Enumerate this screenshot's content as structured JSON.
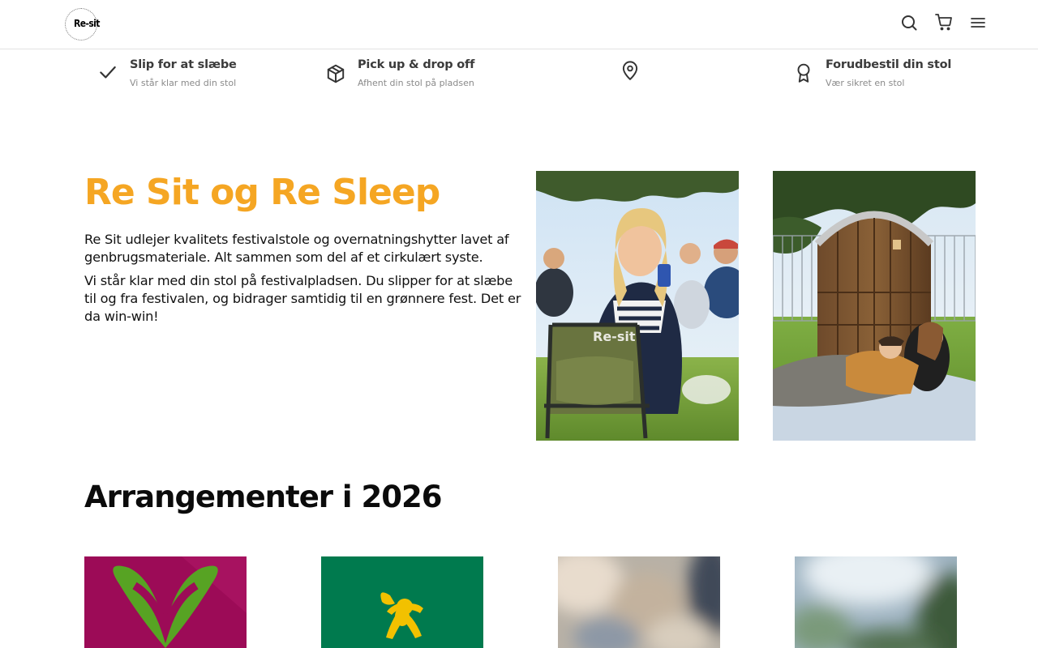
{
  "brand": {
    "logo_text": "Re-sit",
    "accent": "#f5a623"
  },
  "header": {
    "icons": [
      "search-icon",
      "cart-icon",
      "menu-icon"
    ]
  },
  "usps": [
    {
      "icon": "check-icon",
      "title": "Slip for at slæbe",
      "subtitle": "Vi står klar med din stol"
    },
    {
      "icon": "box-icon",
      "title": "Pick up & drop off",
      "subtitle": "Afhent din stol på pladsen"
    },
    {
      "icon": "map-pin-icon",
      "title": "",
      "subtitle": ""
    },
    {
      "icon": "award-icon",
      "title": "Forudbestil din stol",
      "subtitle": "Vær sikret en stol"
    }
  ],
  "hero": {
    "title": "Re Sit og Re Sleep",
    "paragraph_1": "Re Sit udlejer kvalitets festivalstole og overnatningshytter lavet af genbrugsmateriale. Alt sammen som del af et cirkulært syste.",
    "paragraph_2": "Vi står klar med din stol på festivalpladsen. Du slipper for at slæbe til og fra festivalen, og bidrager samtidig til en grønnere fest. Det er da win-win!",
    "photos": [
      {
        "name": "festival-chair-photo",
        "chair_print": "Re-sit"
      },
      {
        "name": "sleeping-hut-photo"
      }
    ]
  },
  "events": {
    "title": "Arrangementer i 2026",
    "cards": [
      {
        "name": "event-card-1",
        "bg": "#9c0b57"
      },
      {
        "name": "event-card-2",
        "bg": "#007a4e"
      },
      {
        "name": "event-card-3",
        "bg": "#b6aea2"
      },
      {
        "name": "event-card-4",
        "bg": "#8aa3b3"
      }
    ]
  }
}
